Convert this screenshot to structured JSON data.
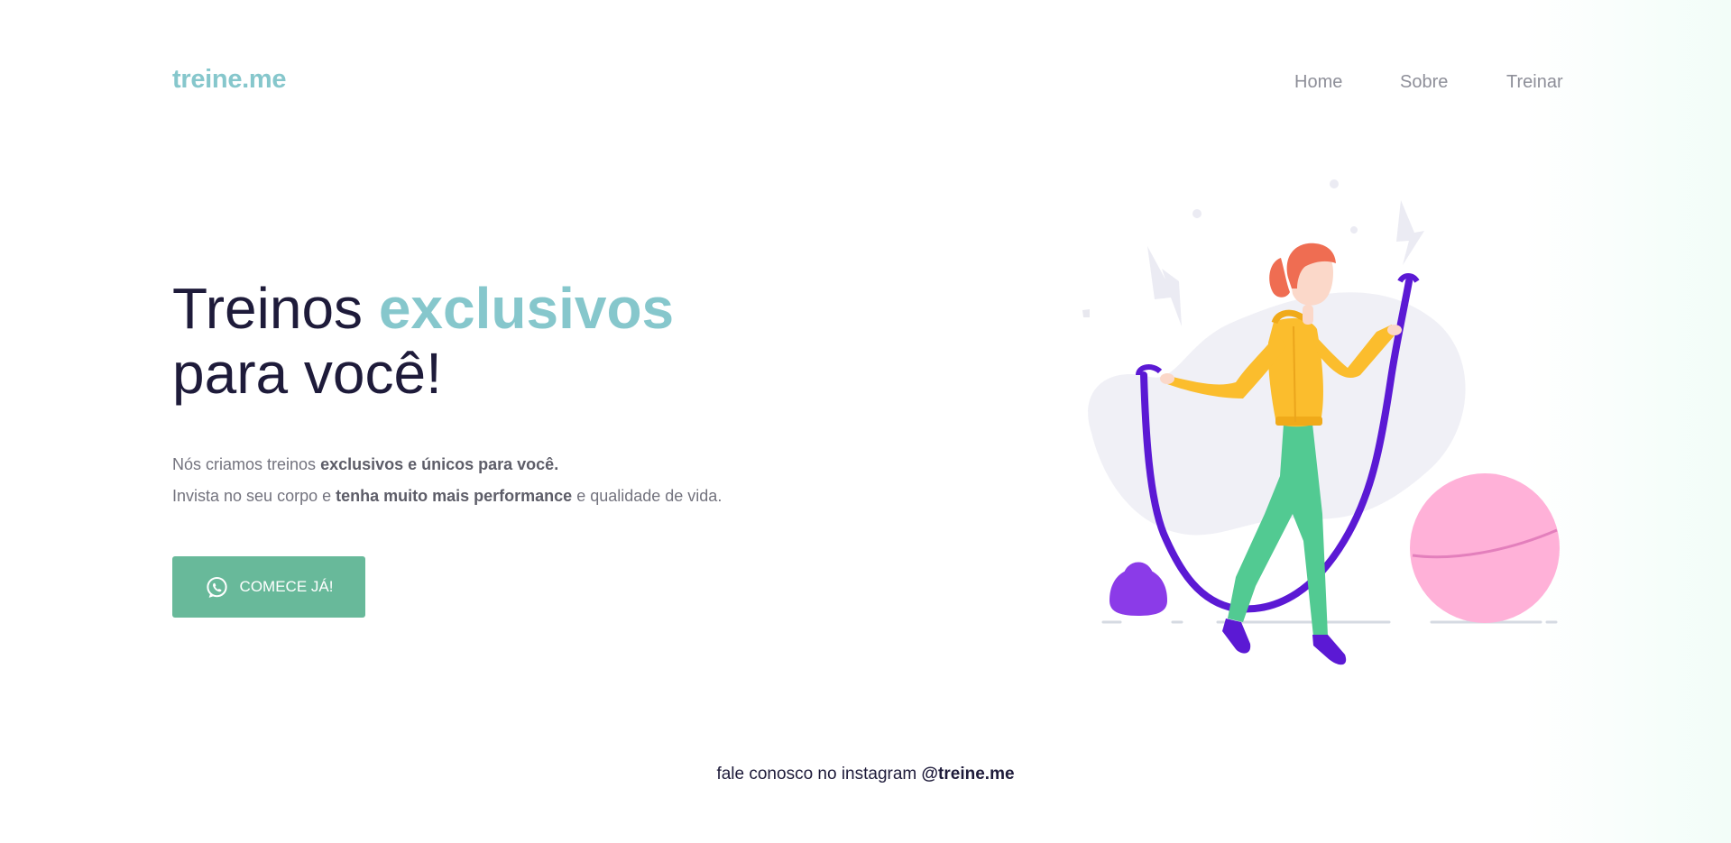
{
  "header": {
    "logo": "treine.me",
    "nav": [
      "Home",
      "Sobre",
      "Treinar"
    ]
  },
  "hero": {
    "title_line1_prefix": "Treinos ",
    "title_line1_accent": "exclusivos",
    "title_line2": "para você!",
    "line1_text": "Nós criamos treinos ",
    "line1_bold": "exclusivos e únicos para você.",
    "line2_text": "Invista no seu corpo e ",
    "line2_bold": "tenha muito mais performance",
    "line2_suffix": " e qualidade de vida.",
    "cta_label": "COMECE JÁ!",
    "cta_icon": "whatsapp-icon"
  },
  "footer": {
    "text": "fale conosco no instagram ",
    "handle": "@treine.me"
  },
  "colors": {
    "accent": "#86c7cc",
    "button": "#68b99a",
    "dark_text": "#1e1b3a",
    "muted_text": "#73737e"
  }
}
